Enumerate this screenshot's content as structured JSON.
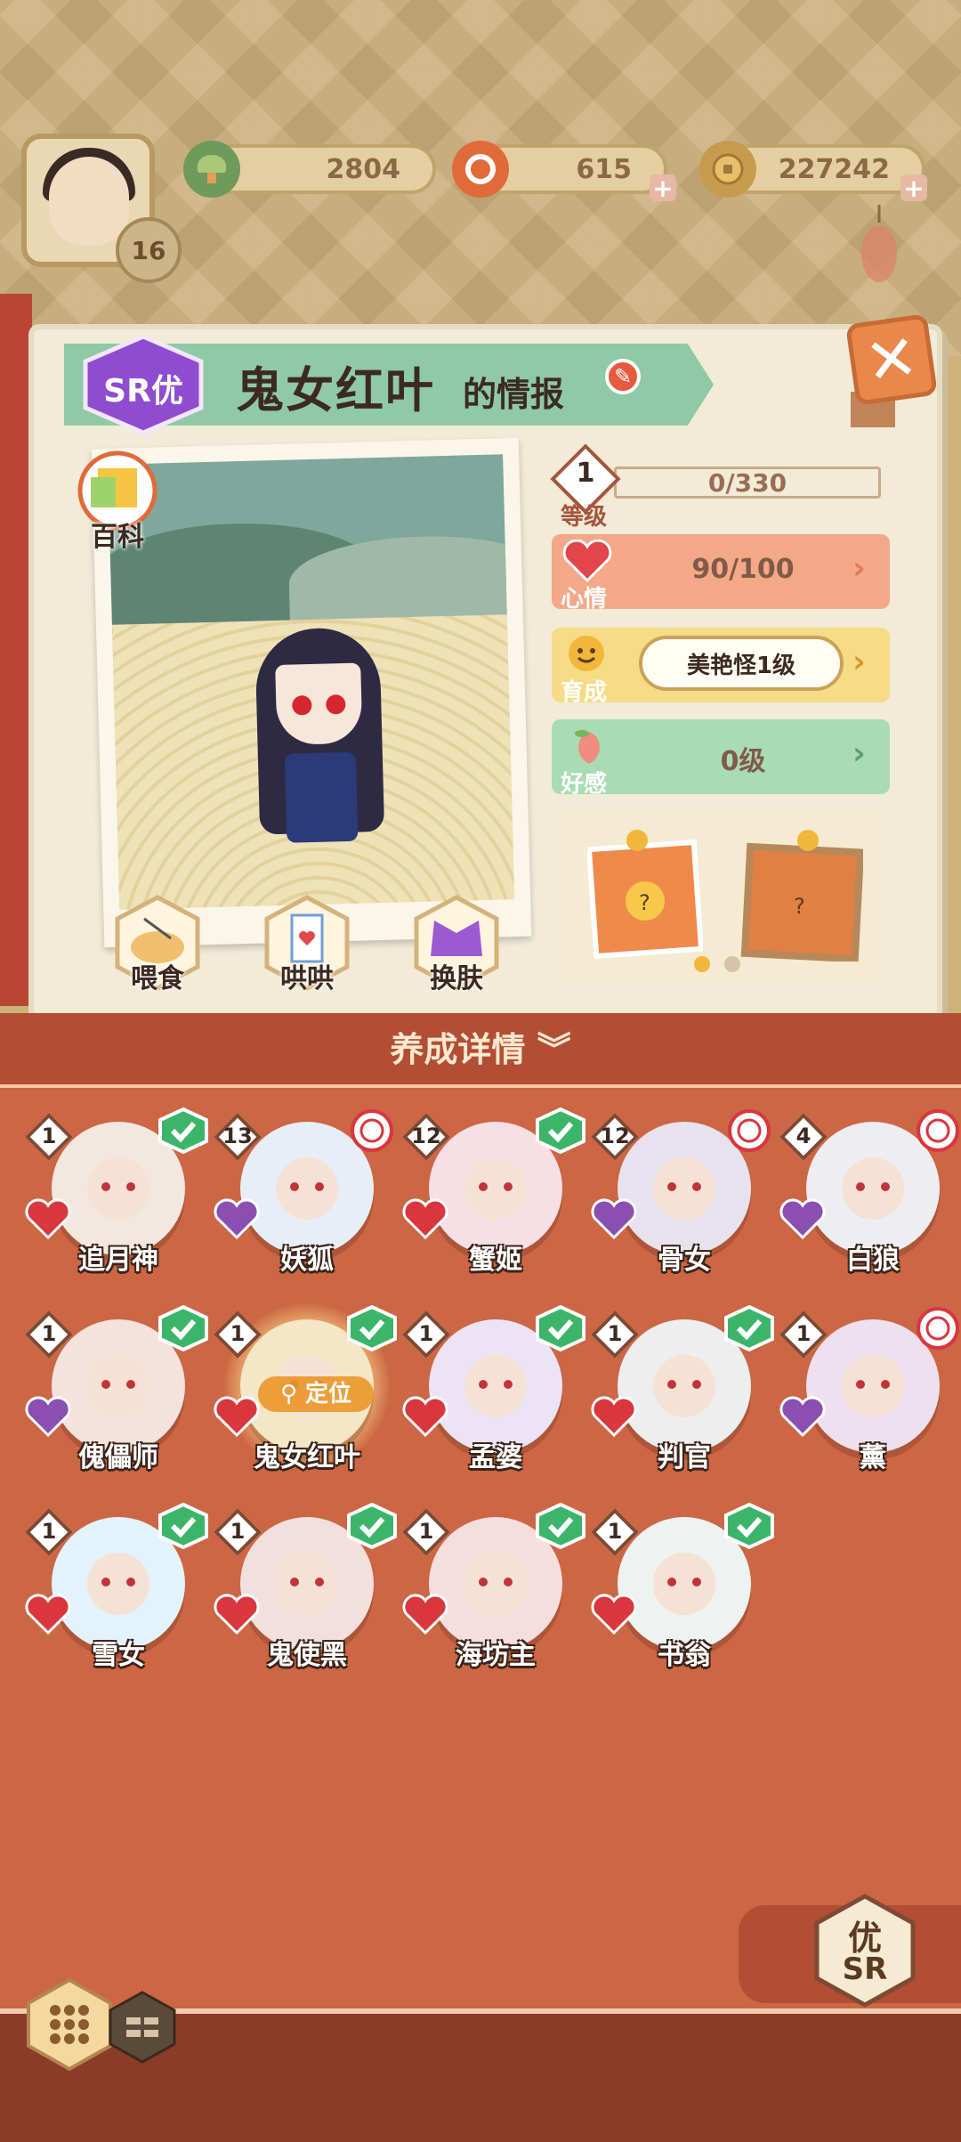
{
  "header": {
    "player_level": "16",
    "resources": [
      {
        "name": "jade",
        "value": "2804"
      },
      {
        "name": "stamina",
        "value": "615"
      },
      {
        "name": "coins",
        "value": "227242"
      }
    ]
  },
  "info": {
    "rarity_badge": "SR优",
    "title_name": "鬼女红叶",
    "title_suffix": "的情报",
    "encyclopedia_label": "百科",
    "level": {
      "value": "1",
      "label": "等级",
      "exp": "0/330"
    },
    "mood": {
      "label": "心情",
      "value": "90/100"
    },
    "growth": {
      "label": "育成",
      "value": "美艳怪1级"
    },
    "affinity": {
      "label": "好感",
      "value": "0级"
    },
    "actions": [
      {
        "label": "喂食"
      },
      {
        "label": "哄哄"
      },
      {
        "label": "换肤"
      }
    ]
  },
  "details": {
    "title": "养成详情",
    "locate_label": "定位",
    "shikigami": [
      {
        "name": "追月神",
        "level": "1",
        "status": "check",
        "heart": "red"
      },
      {
        "name": "妖狐",
        "level": "13",
        "status": "ring",
        "heart": "purple"
      },
      {
        "name": "蟹姬",
        "level": "12",
        "status": "check",
        "heart": "red"
      },
      {
        "name": "骨女",
        "level": "12",
        "status": "ring",
        "heart": "purple"
      },
      {
        "name": "白狼",
        "level": "4",
        "status": "ring",
        "heart": "purple"
      },
      {
        "name": "傀儡师",
        "level": "1",
        "status": "check",
        "heart": "purple"
      },
      {
        "name": "鬼女红叶",
        "level": "1",
        "status": "check",
        "heart": "red",
        "selected": true
      },
      {
        "name": "孟婆",
        "level": "1",
        "status": "check",
        "heart": "red"
      },
      {
        "name": "判官",
        "level": "1",
        "status": "check",
        "heart": "red"
      },
      {
        "name": "薰",
        "level": "1",
        "status": "ring",
        "heart": "purple"
      },
      {
        "name": "雪女",
        "level": "1",
        "status": "check",
        "heart": "red"
      },
      {
        "name": "鬼使黑",
        "level": "1",
        "status": "check",
        "heart": "red"
      },
      {
        "name": "海坊主",
        "level": "1",
        "status": "check",
        "heart": "red"
      },
      {
        "name": "书翁",
        "level": "1",
        "status": "check",
        "heart": "red"
      }
    ]
  },
  "sort_tab": {
    "line1": "优",
    "line2": "SR"
  },
  "colors": {
    "accent_red": "#cc6644",
    "check_green": "#3cb56a",
    "heart_red": "#d9363e",
    "heart_purple": "#8a4fb0"
  }
}
